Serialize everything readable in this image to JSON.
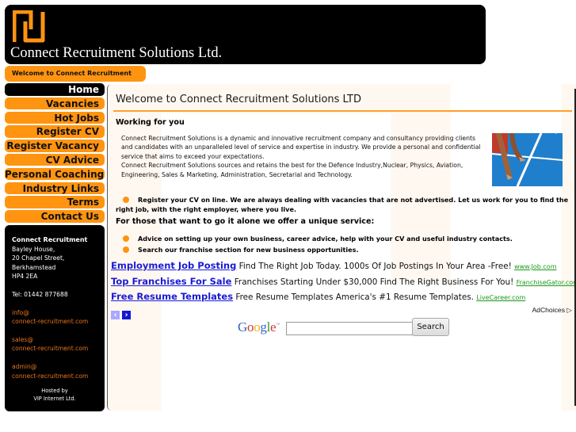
{
  "header": {
    "site_title": "Connect Recruitment Solutions Ltd.",
    "logo_icon": "connect-logo-icon",
    "brand_color": "#ff9410",
    "welcome_tab": "Welcome to Connect Recruitment"
  },
  "nav": {
    "items": [
      {
        "label": "Home",
        "active": true
      },
      {
        "label": "Vacancies"
      },
      {
        "label": "Hot Jobs"
      },
      {
        "label": "Register CV"
      },
      {
        "label": "Register Vacancy"
      },
      {
        "label": "CV Advice"
      },
      {
        "label": "Personal Coaching"
      },
      {
        "label": "Industry Links"
      },
      {
        "label": "Terms"
      },
      {
        "label": "Contact Us"
      }
    ]
  },
  "contact": {
    "org": "Connect Recruitment",
    "address": [
      "Bayley House,",
      "20 Chapel Street,",
      "Berkhamstead",
      "HP4 2EA"
    ],
    "tel": "Tel: 01442 877688",
    "emails": [
      {
        "user": "info@",
        "domain": "connect-recruitment.com"
      },
      {
        "user": "sales@",
        "domain": "connect-recruitment.com"
      },
      {
        "user": "admin@",
        "domain": "connect-recruitment.com"
      }
    ],
    "hosted_line1": "Hosted by",
    "hosted_line2": "VIP Internet Ltd."
  },
  "main": {
    "title": "Welcome to Connect Recruitment Solutions LTD",
    "section_head": "Working for you",
    "intro": [
      "Connect Recruitment Solutions is a dynamic and innovative recruitment company and consultancy providing clients and candidates with an unparalleled level of service and expertise in industry. We provide a personal and confidential service that aims to exceed your expectations.",
      "Connect Recruitment Solutions sources and retains the best for the Defence Industry,Nuclear, Physics, Aviation, Engineering, Sales & Marketing, Administration, Secretarial and Technology."
    ],
    "photo_alt": "sprinter-start-photo",
    "bullet_register": "Register your CV on line. We are always dealing with vacancies that are not advertised. Let us work for you to find the",
    "bullet_register_cont": "right job, with the right employer, where you live.",
    "service_head": "For those that want to go it alone we offer a unique service:",
    "bullet_advice": "Advice on setting up your own business, career advice, help with your CV and useful industry contacts.",
    "bullet_franchise": "Search our franchise section for new business opportunities."
  },
  "ads": {
    "items": [
      {
        "headline": "Employment Job Posting",
        "desc": "Find The Right Job Today. 1000s Of Job Postings In Your Area -Free!",
        "url": "www.Job.com"
      },
      {
        "headline": "Top Franchises For Sale",
        "desc": "Franchises Starting Under $30,000 Find The Right Business For You!",
        "url": "FranchiseGator.com"
      },
      {
        "headline": "Free Resume Templates",
        "desc": "Free Resume Templates America's #1 Resume Templates.",
        "url": "LiveCareer.com"
      }
    ],
    "prev": "‹",
    "next": "›",
    "adchoices": "AdChoices ▷"
  },
  "search": {
    "logo_text": "Google",
    "tm": "™",
    "query": "",
    "button": "Search"
  }
}
